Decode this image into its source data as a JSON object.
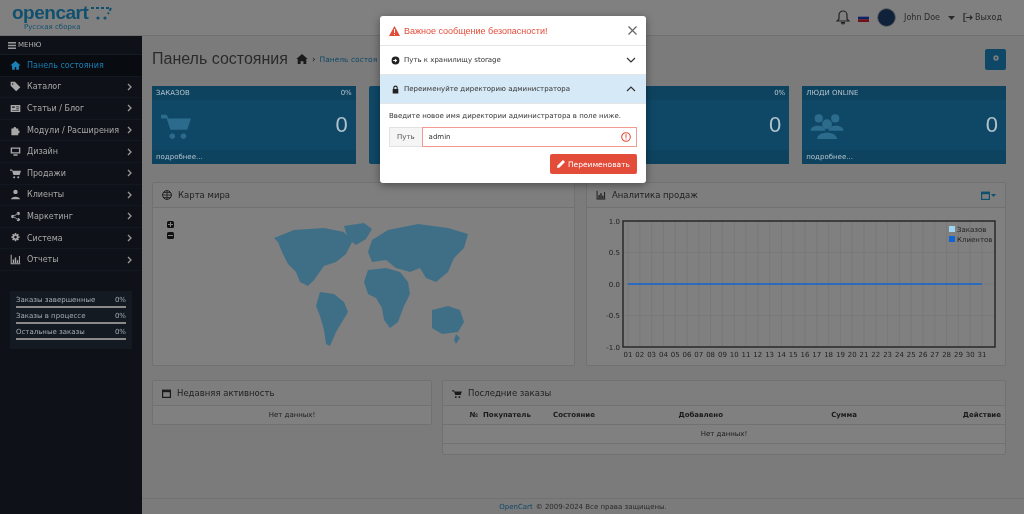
{
  "header": {
    "logo": "opencart",
    "logo_sub": "Русская сборка",
    "user": "John Doe",
    "logout": "Выход"
  },
  "sidebar": {
    "menu_label": "МЕНЮ",
    "items": [
      {
        "label": "Панель состояния",
        "selected": true,
        "submenu": false
      },
      {
        "label": "Каталог",
        "selected": false,
        "submenu": true
      },
      {
        "label": "Статьи / Блог",
        "selected": false,
        "submenu": true
      },
      {
        "label": "Модули / Расширения",
        "selected": false,
        "submenu": true
      },
      {
        "label": "Дизайн",
        "selected": false,
        "submenu": true
      },
      {
        "label": "Продажи",
        "selected": false,
        "submenu": true
      },
      {
        "label": "Клиенты",
        "selected": false,
        "submenu": true
      },
      {
        "label": "Маркетинг",
        "selected": false,
        "submenu": true
      },
      {
        "label": "Система",
        "selected": false,
        "submenu": true
      },
      {
        "label": "Отчеты",
        "selected": false,
        "submenu": true
      }
    ],
    "stats": [
      {
        "label": "Заказы завершенные",
        "value": "0%"
      },
      {
        "label": "Заказы в процессе",
        "value": "0%"
      },
      {
        "label": "Остальные заказы",
        "value": "0%"
      }
    ]
  },
  "page": {
    "title": "Панель состояния",
    "separator": "›",
    "breadcrumb": "Панель состоя"
  },
  "tiles": [
    {
      "title": "ЗАКАЗОВ",
      "percent": "0%",
      "value": "0",
      "more": "подробнее..."
    },
    {
      "percent": "0%",
      "value": "0"
    },
    {
      "title": "ЛЮДИ ONLINE",
      "value": "0",
      "more": "подробнее..."
    }
  ],
  "map": {
    "title": "Карта мира"
  },
  "sales": {
    "title": "Аналитика продаж",
    "chart_data": {
      "type": "line",
      "grid": true,
      "legend": true,
      "x": [
        "01",
        "02",
        "03",
        "04",
        "05",
        "06",
        "07",
        "08",
        "09",
        "10",
        "11",
        "12",
        "13",
        "14",
        "15",
        "16",
        "17",
        "18",
        "19",
        "20",
        "21",
        "22",
        "23",
        "24",
        "25",
        "26",
        "27",
        "28",
        "29",
        "30",
        "31"
      ],
      "ylim": [
        -1,
        1
      ],
      "yticks": [
        {
          "value": -1,
          "label": "-1.0"
        },
        {
          "value": -0.5,
          "label": "-0.5"
        },
        {
          "value": 0,
          "label": "0.0"
        },
        {
          "value": 0.5,
          "label": "0.5"
        },
        {
          "value": 1,
          "label": "1.0"
        }
      ],
      "series": [
        {
          "name": "Заказов",
          "color": "#9fd5f1",
          "values": [
            null,
            null,
            null,
            null,
            null,
            null,
            null,
            null,
            null,
            null,
            null,
            null,
            null,
            null,
            null,
            null,
            null,
            null,
            null,
            null,
            null,
            null,
            null,
            null,
            null,
            null,
            null,
            null,
            null,
            null,
            null
          ]
        },
        {
          "name": "Клиентов",
          "color": "#1065d2",
          "values": [
            0,
            0,
            0,
            0,
            0,
            0,
            0,
            0,
            0,
            0,
            0,
            0,
            0,
            0,
            0,
            0,
            0,
            0,
            0,
            0,
            0,
            0,
            0,
            0,
            0,
            0,
            0,
            0,
            0,
            0,
            0
          ]
        }
      ]
    }
  },
  "activity": {
    "title": "Недавняя активность",
    "empty": "Нет данных!"
  },
  "orders": {
    "title": "Последние заказы",
    "columns": [
      "№",
      "Покупатель",
      "Состояние",
      "Добавлено",
      "Сумма",
      "Действие"
    ],
    "empty": "Нет данных!"
  },
  "footer": {
    "brand": "OpenCart",
    "text": "© 2009-2024 Все права защищены."
  },
  "modal": {
    "title": "Важное сообщение безопасности!",
    "sections": [
      {
        "label": "Путь к хранилищу storage",
        "expanded": false
      },
      {
        "label": "Переименуйте директорию администратора",
        "expanded": true
      }
    ],
    "description": "Введите новое имя директории администратора в поле ниже.",
    "input_label": "Путь",
    "value": "admin",
    "invalid": true,
    "button": "Переименовать"
  }
}
